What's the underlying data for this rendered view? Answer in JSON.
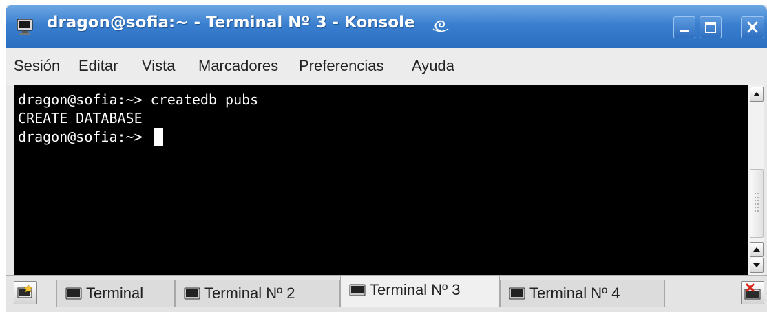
{
  "window": {
    "title": "dragon@sofia:~ - Terminal Nº 3 - Konsole",
    "buttons": {
      "minimize": "_",
      "maximize": "□",
      "close": "×"
    }
  },
  "menubar": {
    "items": [
      {
        "label": "Sesión"
      },
      {
        "label": "Editar"
      },
      {
        "label": "Vista"
      },
      {
        "label": "Marcadores"
      },
      {
        "label": "Preferencias"
      },
      {
        "label": "Ayuda"
      }
    ]
  },
  "terminal": {
    "lines": [
      "dragon@sofia:~> createdb pubs",
      "CREATE DATABASE",
      "dragon@sofia:~> "
    ]
  },
  "tabs": [
    {
      "label": "Terminal",
      "active": false
    },
    {
      "label": "Terminal Nº 2",
      "active": false
    },
    {
      "label": "Terminal Nº 3",
      "active": true
    },
    {
      "label": "Terminal Nº 4",
      "active": false
    }
  ],
  "colors": {
    "titlebar": "#3a7fcf",
    "terminal_bg": "#000000",
    "terminal_fg": "#ffffff"
  },
  "icons": {
    "app": "terminal-icon",
    "title_decoration": "spiral-icon",
    "new_session": "new-session-icon",
    "close_session": "close-session-icon",
    "tab": "monitor-icon"
  }
}
